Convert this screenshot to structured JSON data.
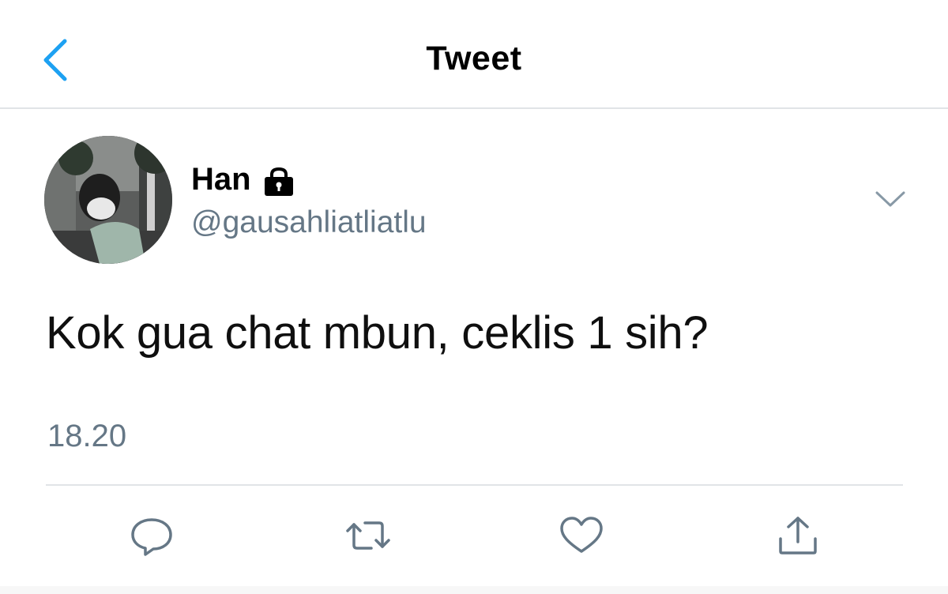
{
  "header": {
    "title": "Tweet",
    "back_icon": "chevron-left-icon"
  },
  "tweet": {
    "author": {
      "display_name": "Han",
      "handle": "@gausahliatliatlu",
      "protected_icon": "lock-icon",
      "avatar": "profile-photo"
    },
    "text": "Kok gua chat mbun, ceklis 1 sih?",
    "time": "18.20",
    "more_icon": "chevron-down-icon"
  },
  "actions": [
    {
      "name": "reply",
      "icon": "reply-icon"
    },
    {
      "name": "retweet",
      "icon": "retweet-icon"
    },
    {
      "name": "like",
      "icon": "heart-icon"
    },
    {
      "name": "share",
      "icon": "share-icon"
    }
  ],
  "colors": {
    "accent": "#1da1f2",
    "secondary_text": "#657786",
    "divider": "#e1e4e7",
    "icon_gray": "#657786"
  }
}
